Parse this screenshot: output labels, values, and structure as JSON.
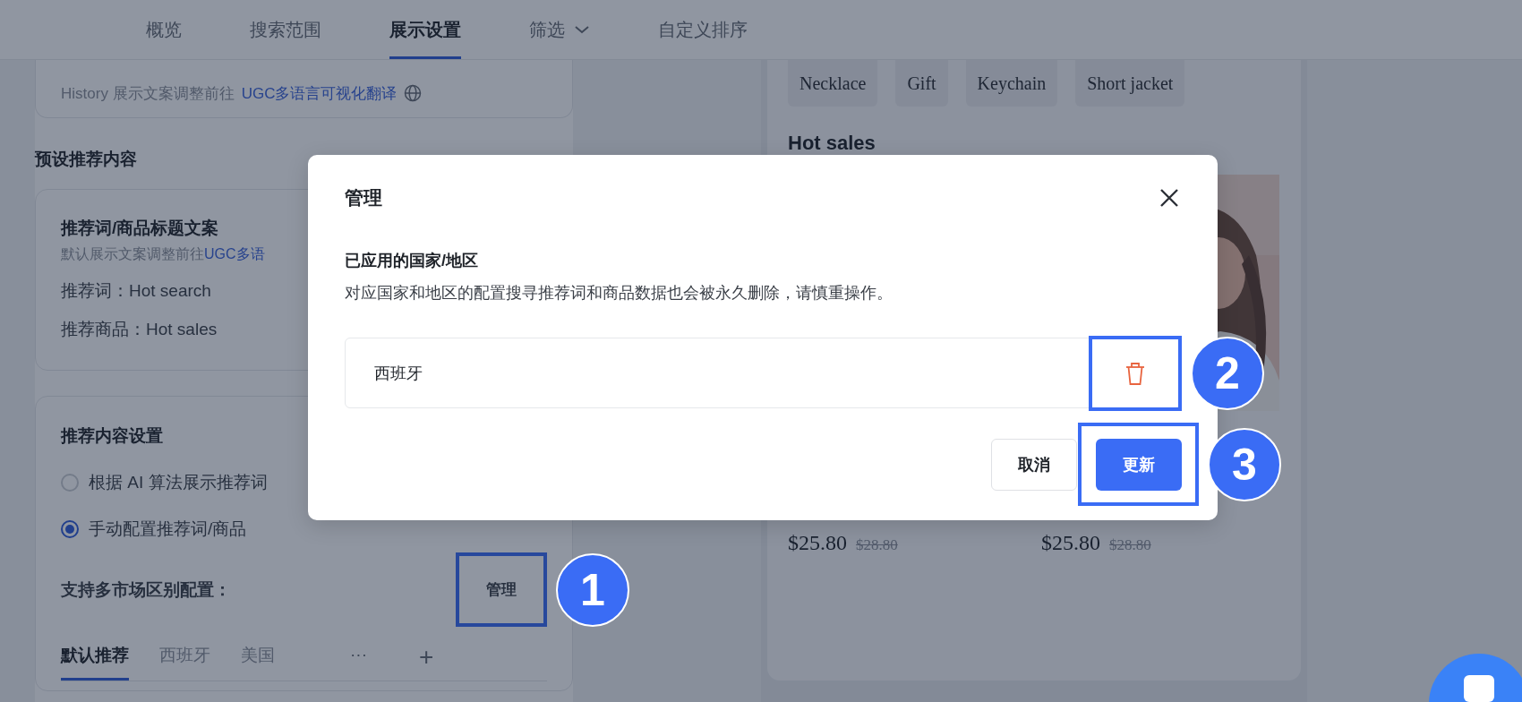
{
  "nav": {
    "tabs": [
      {
        "label": "概览",
        "selected": false,
        "dropdown": false
      },
      {
        "label": "搜索范围",
        "selected": false,
        "dropdown": false
      },
      {
        "label": "展示设置",
        "selected": true,
        "dropdown": false
      },
      {
        "label": "筛选",
        "selected": false,
        "dropdown": true
      },
      {
        "label": "自定义排序",
        "selected": false,
        "dropdown": false
      }
    ]
  },
  "settings": {
    "history_note": {
      "text": "History 展示文案调整前往",
      "link": "UGC多语言可视化翻译"
    },
    "section_title": "预设推荐内容",
    "title_card": {
      "title": "推荐词/商品标题文案",
      "note": "默认展示文案调整前往",
      "link": "UGC多语",
      "lines": [
        "推荐词：Hot search",
        "推荐商品：Hot sales"
      ]
    },
    "content_card": {
      "title": "推荐内容设置",
      "options": [
        {
          "label": "根据 AI 算法展示推荐词",
          "selected": false
        },
        {
          "label": "手动配置推荐词/商品",
          "selected": true
        }
      ],
      "market_label": "支持多市场区别配置：",
      "manage_button": "管理",
      "market_tabs": [
        {
          "label": "默认推荐",
          "selected": true
        },
        {
          "label": "西班牙",
          "selected": false
        },
        {
          "label": "美国",
          "selected": false
        }
      ],
      "more": "···",
      "add": "+"
    }
  },
  "preview": {
    "tags": [
      "Necklace",
      "Gift",
      "Keychain",
      "Short jacket"
    ],
    "section_title": "Hot sales",
    "products": [
      {
        "kind": "hidden",
        "price": "$25.80",
        "original_price": "$28.80"
      },
      {
        "kind": "picture",
        "price": "$25.80",
        "original_price": "$28.80"
      }
    ]
  },
  "dialog": {
    "title": "管理",
    "subtitle": "已应用的国家/地区",
    "description": "对应国家和地区的配置搜寻推荐词和商品数据也会被永久删除，请慎重操作。",
    "regions": [
      "西班牙"
    ],
    "buttons": [
      {
        "label": "取消",
        "kind": "secondary"
      },
      {
        "label": "更新",
        "kind": "primary"
      }
    ]
  },
  "annotations": {
    "manage": "1",
    "delete": "2",
    "update": "3"
  }
}
